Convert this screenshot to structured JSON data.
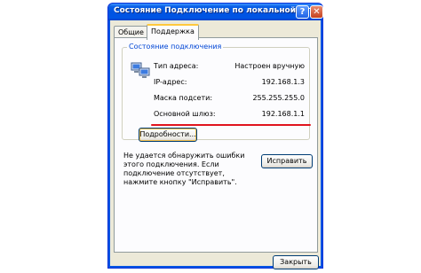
{
  "window": {
    "title": "Состояние Подключение по локальной сети",
    "help_label": "?",
    "close_label": "✕"
  },
  "tabs": [
    {
      "label": "Общие",
      "active": false
    },
    {
      "label": "Поддержка",
      "active": true
    }
  ],
  "status_group": {
    "label": "Состояние подключения",
    "icon": "network-connection-icon",
    "rows": [
      {
        "key": "Тип адреса:",
        "value": "Настроен вручную"
      },
      {
        "key": "IP-адрес:",
        "value": "192.168.1.3"
      },
      {
        "key": "Маска подсети:",
        "value": "255.255.255.0"
      },
      {
        "key": "Основной шлюз:",
        "value": "192.168.1.1"
      }
    ],
    "details_button": "Подробности..."
  },
  "info": {
    "text": "Не удается обнаружить ошибки этого подключения. Если подключение отсутствует, нажмите кнопку \"Исправить\".",
    "repair_button": "Исправить"
  },
  "footer": {
    "close_button": "Закрыть"
  },
  "colors": {
    "title_bar": "#0054e3",
    "highlight_underline": "#e0141e",
    "group_label": "#0046d5"
  }
}
